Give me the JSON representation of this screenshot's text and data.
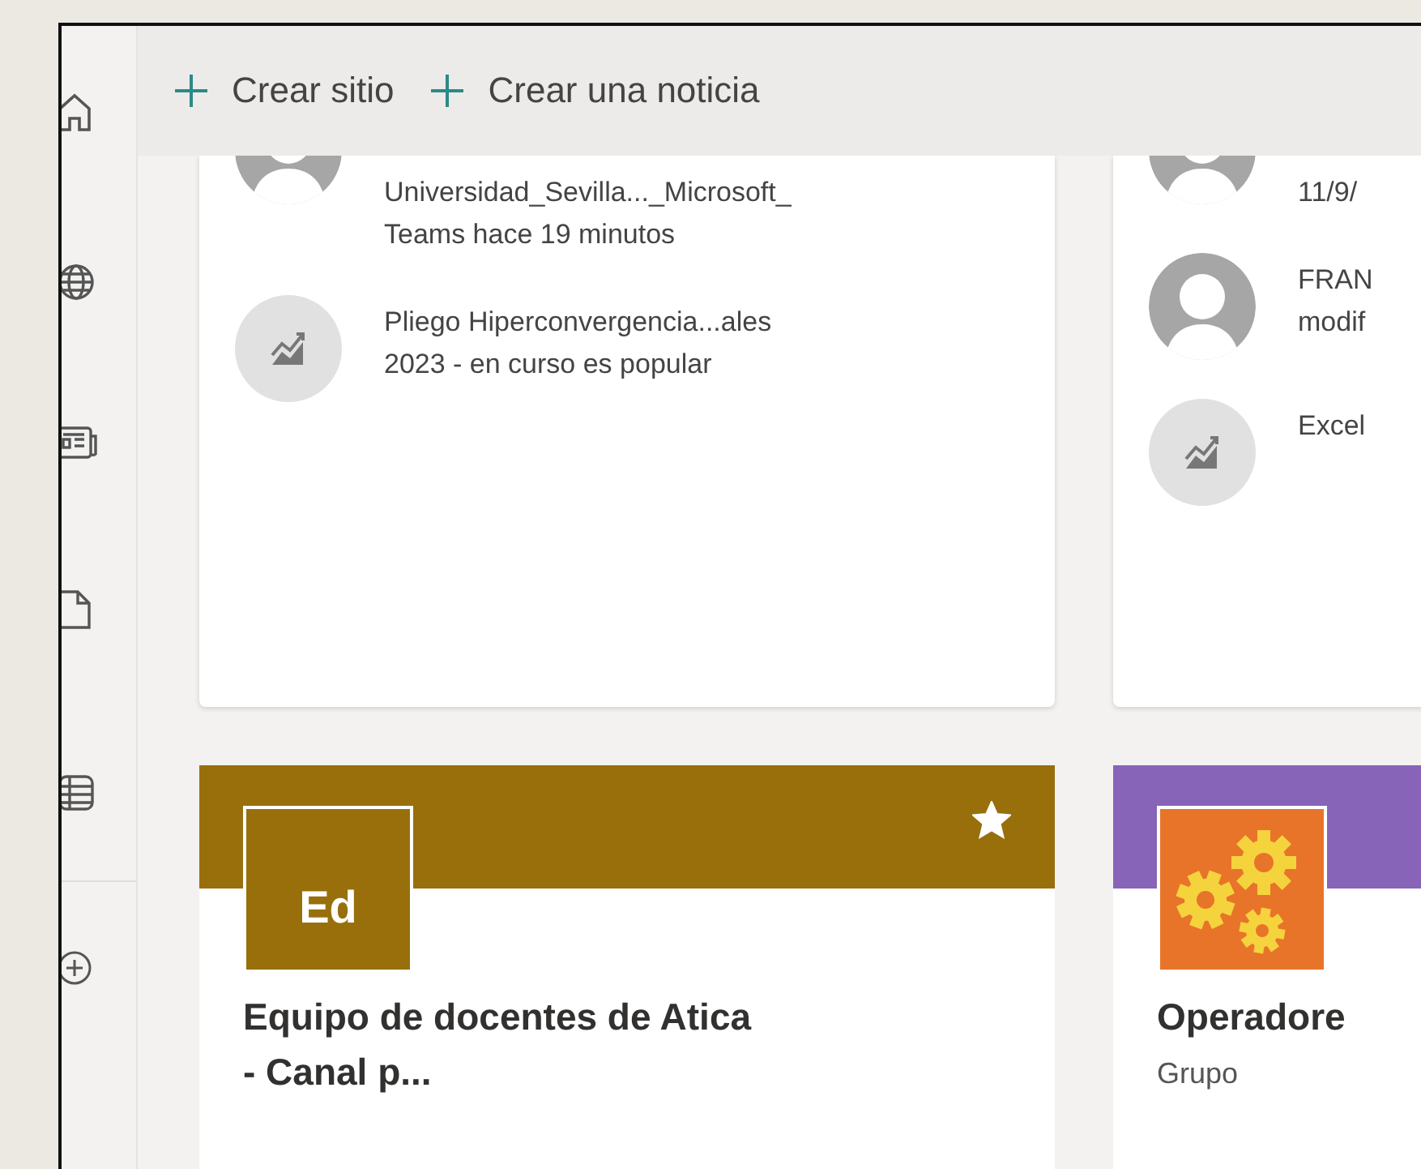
{
  "toolbar": [
    {
      "label": "Crear sitio"
    },
    {
      "label": "Crear una noticia"
    }
  ],
  "activity_cards": [
    {
      "items": [
        {
          "kind": "person",
          "lines": [
            "Universidad_Sevilla..._Microsoft_",
            "Teams hace 19 minutos"
          ]
        },
        {
          "kind": "trending",
          "lines": [
            "Pliego Hiperconvergencia...ales",
            "2023 - en curso es popular"
          ]
        }
      ]
    },
    {
      "items": [
        {
          "kind": "person",
          "lines": [
            "11/9/"
          ]
        },
        {
          "kind": "person",
          "lines": [
            "FRAN",
            "modif"
          ]
        },
        {
          "kind": "trending",
          "lines": [
            "Excel"
          ]
        }
      ]
    }
  ],
  "site_cards": [
    {
      "color": "#986f0b",
      "logo": {
        "kind": "initials",
        "text": "Ed"
      },
      "title_lines": [
        "Equipo de docentes de Atica",
        "- Canal p..."
      ],
      "favorite": true
    },
    {
      "color": "#8764b8",
      "logo": {
        "kind": "gears"
      },
      "title_lines": [
        "Operadore"
      ],
      "subtitle": "Grupo"
    }
  ]
}
